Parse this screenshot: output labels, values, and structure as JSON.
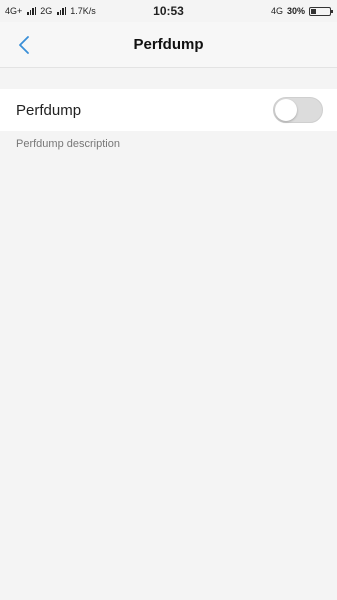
{
  "status_bar": {
    "network_left": "4G+",
    "network_2g": "2G",
    "speed": "1.7K/s",
    "time": "10:53",
    "network_right": "4G",
    "battery_percent": "30%",
    "battery_level": 0.3
  },
  "header": {
    "title": "Perfdump",
    "back_icon": "chevron-left-icon",
    "accent_color": "#3a8fd8"
  },
  "setting": {
    "label": "Perfdump",
    "description": "Perfdump description",
    "toggle_on": false
  }
}
